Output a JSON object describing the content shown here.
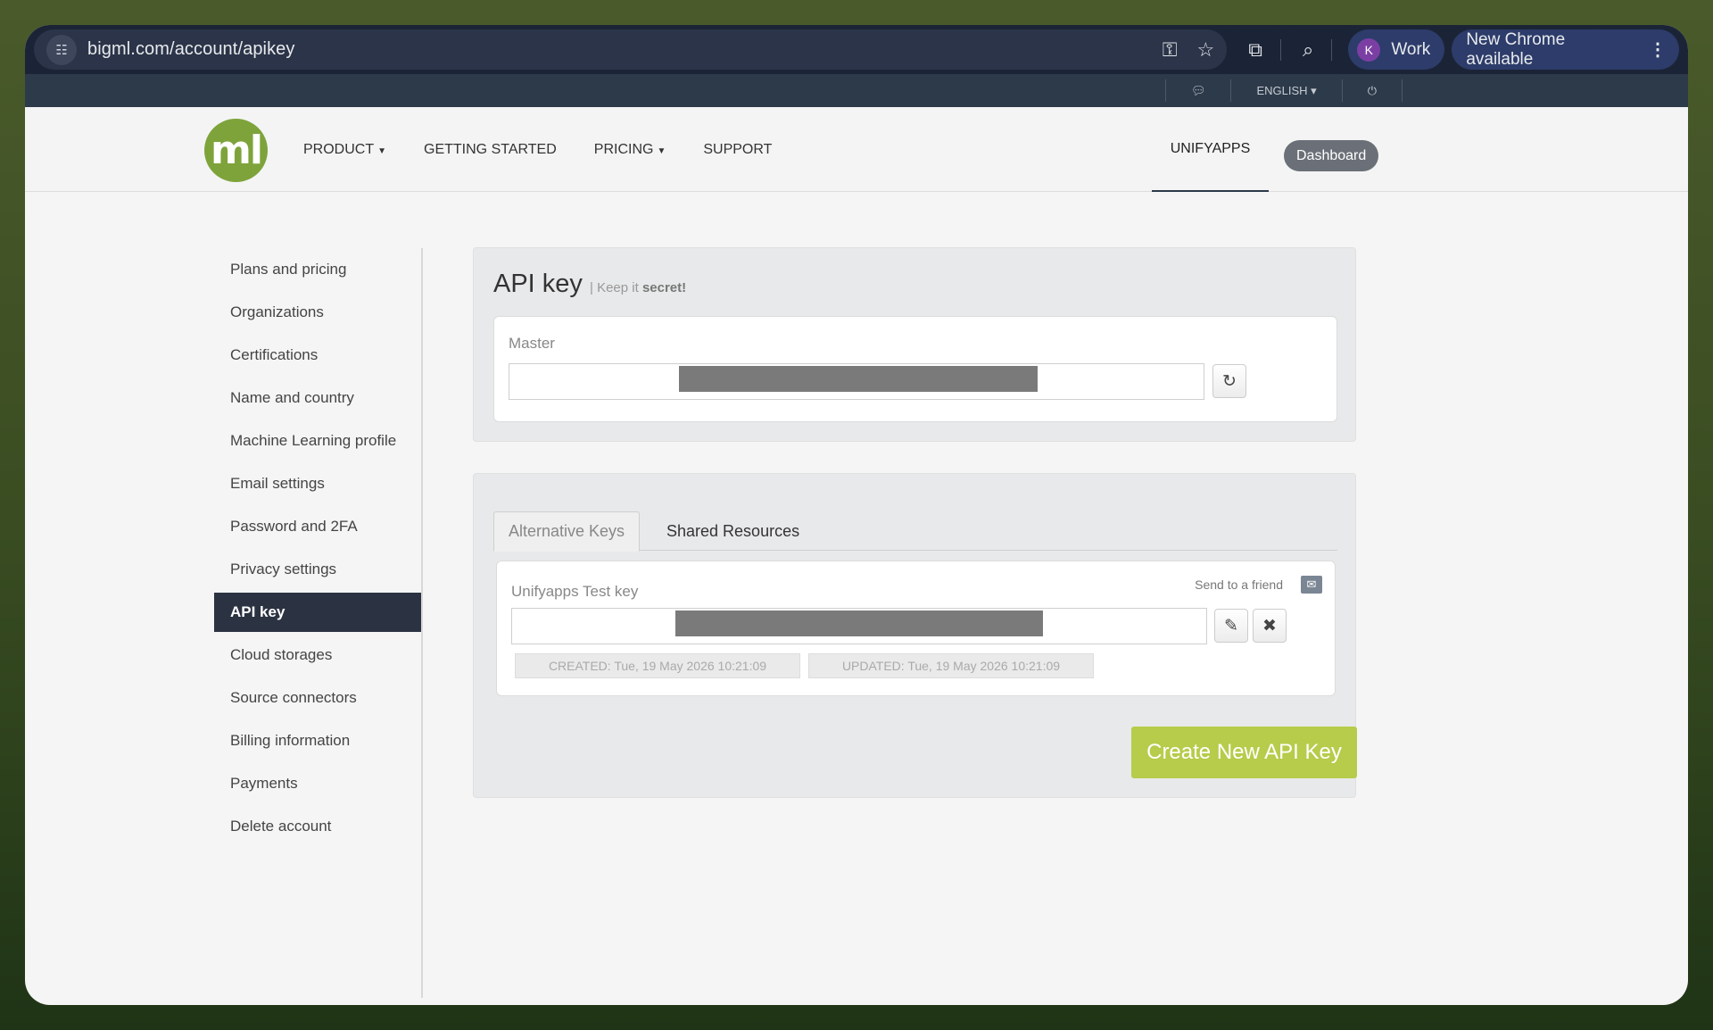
{
  "browser": {
    "url": "bigml.com/account/apikey",
    "profile_initial": "K",
    "profile_name": "Work",
    "update_label": "New Chrome available"
  },
  "topstrip": {
    "language": "ENGLISH ▾"
  },
  "navbar": {
    "logo_text": "ml",
    "items": [
      {
        "label": "PRODUCT",
        "caret": true
      },
      {
        "label": "GETTING STARTED",
        "caret": false
      },
      {
        "label": "PRICING",
        "caret": true
      },
      {
        "label": "SUPPORT",
        "caret": false
      }
    ],
    "user": "UNIFYAPPS",
    "dashboard": "Dashboard"
  },
  "sidebar": {
    "items": [
      "Plans and pricing",
      "Organizations",
      "Certifications",
      "Name and country",
      "Machine Learning profile",
      "Email settings",
      "Password and 2FA",
      "Privacy settings",
      "API key",
      "Cloud storages",
      "Source connectors",
      "Billing information",
      "Payments",
      "Delete account"
    ],
    "active": "API key"
  },
  "api_panel": {
    "title": "API key",
    "subtitle_prefix": "| Keep it ",
    "subtitle_bold": "secret!",
    "master_label": "Master"
  },
  "alt_panel": {
    "tabs": [
      "Alternative Keys",
      "Shared Resources"
    ],
    "key_name": "Unifyapps Test key",
    "send_label": "Send to a friend",
    "created": "CREATED: Tue, 19 May 2026 10:21:09",
    "updated": "UPDATED: Tue, 19 May 2026 10:21:09",
    "create_button": "Create New API Key"
  }
}
